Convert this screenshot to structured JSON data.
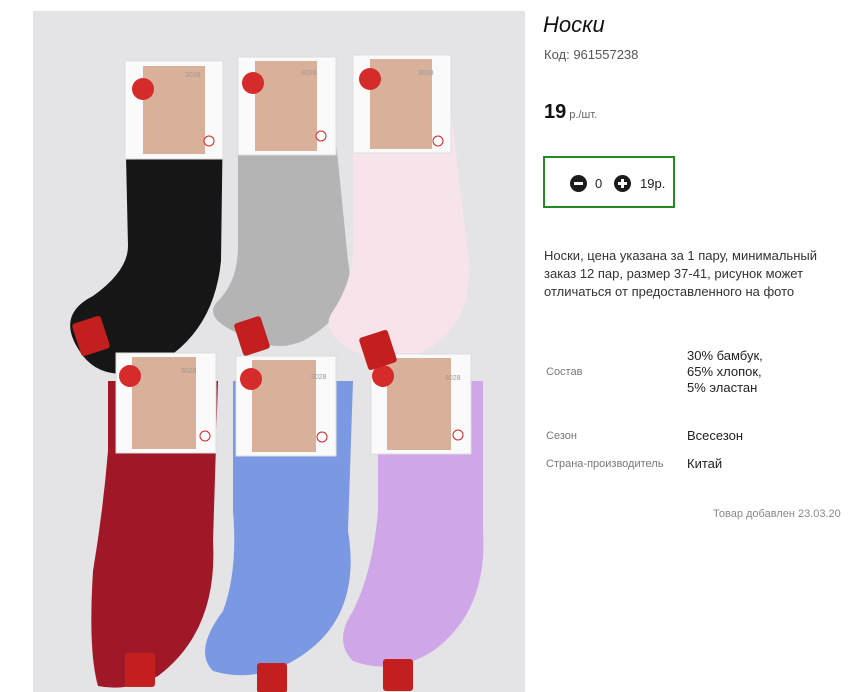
{
  "product": {
    "image_alt": "Носки",
    "title": "Носки",
    "code": "Код: 961557238",
    "price": {
      "value": "19",
      "unit": "р./шт."
    },
    "cart": {
      "quantity": "0",
      "sum": "19р."
    },
    "description": "Носки, цена указана за 1 пару, минимальный заказ 12 пар, размер 37-41, рисунок может отличаться от предоставленного на фото",
    "properties": [
      {
        "label": "Состав",
        "value": "30% бамбук, 65% хлопок, 5% эластан"
      },
      {
        "label": "Сезон",
        "value": "Всесезон"
      },
      {
        "label": "Страна-производитель",
        "value": "Китай"
      }
    ],
    "added": "Товар добавлен 23.03.20"
  },
  "photo": {
    "sock_colors": {
      "black": "#161616",
      "grey": "#b4b4b4",
      "pink": "#f7e3ea",
      "red": "#a01827",
      "blue": "#7b99e3",
      "lilac": "#cfa7e8"
    },
    "label_text": "3028"
  },
  "colors": {
    "accent_border": "#228b22",
    "background": "#ffffff"
  }
}
